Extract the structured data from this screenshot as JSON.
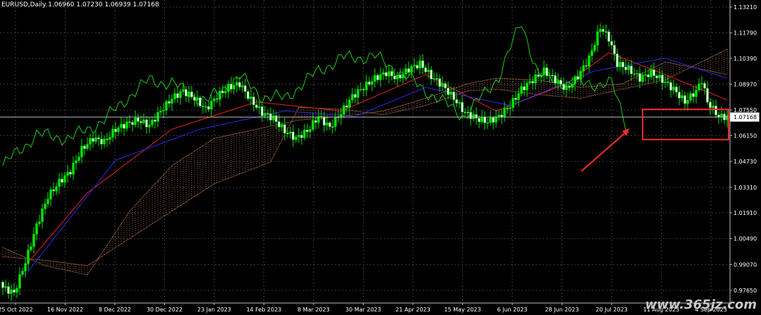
{
  "chart_data": {
    "type": "candlestick",
    "symbol_line": "EURUSD,Daily  1.06960 1.07230 1.06939 1.07168",
    "price_ticks": [
      "1.13210",
      "1.11790",
      "1.10390",
      "1.08970",
      "1.07550",
      "1.06150",
      "1.04730",
      "1.03310",
      "1.01910",
      "1.00490",
      "0.99070",
      "0.97650"
    ],
    "current_price": "1.07168",
    "x_ticks": [
      "25 Oct 2022",
      "16 Nov 2022",
      "8 Dec 2022",
      "30 Dec 2022",
      "23 Jan 2023",
      "14 Feb 2023",
      "8 Mar 2023",
      "30 Mar 2023",
      "21 Apr 2023",
      "15 May 2023",
      "6 Jun 2023",
      "28 Jun 2023",
      "20 Jul 2023",
      "11 Aug 2023",
      "4 Sep 2023"
    ],
    "grid": true,
    "close_keypoints": [
      [
        0,
        0.978
      ],
      [
        4,
        0.975
      ],
      [
        8,
        0.992
      ],
      [
        12,
        1.012
      ],
      [
        16,
        1.028
      ],
      [
        20,
        1.036
      ],
      [
        24,
        1.042
      ],
      [
        28,
        1.054
      ],
      [
        32,
        1.06
      ],
      [
        36,
        1.058
      ],
      [
        40,
        1.065
      ],
      [
        44,
        1.068
      ],
      [
        48,
        1.07
      ],
      [
        52,
        1.067
      ],
      [
        56,
        1.075
      ],
      [
        60,
        1.082
      ],
      [
        64,
        1.086
      ],
      [
        68,
        1.082
      ],
      [
        72,
        1.076
      ],
      [
        76,
        1.083
      ],
      [
        80,
        1.088
      ],
      [
        84,
        1.09
      ],
      [
        88,
        1.081
      ],
      [
        92,
        1.074
      ],
      [
        96,
        1.071
      ],
      [
        100,
        1.064
      ],
      [
        104,
        1.06
      ],
      [
        108,
        1.064
      ],
      [
        112,
        1.072
      ],
      [
        116,
        1.066
      ],
      [
        120,
        1.074
      ],
      [
        124,
        1.083
      ],
      [
        128,
        1.088
      ],
      [
        132,
        1.093
      ],
      [
        136,
        1.096
      ],
      [
        140,
        1.093
      ],
      [
        144,
        1.098
      ],
      [
        148,
        1.101
      ],
      [
        152,
        1.094
      ],
      [
        156,
        1.089
      ],
      [
        160,
        1.082
      ],
      [
        164,
        1.074
      ],
      [
        168,
        1.071
      ],
      [
        172,
        1.069
      ],
      [
        176,
        1.072
      ],
      [
        180,
        1.078
      ],
      [
        184,
        1.087
      ],
      [
        188,
        1.092
      ],
      [
        192,
        1.097
      ],
      [
        196,
        1.092
      ],
      [
        200,
        1.087
      ],
      [
        204,
        1.094
      ],
      [
        208,
        1.104
      ],
      [
        212,
        1.121
      ],
      [
        215,
        1.115
      ],
      [
        218,
        1.101
      ],
      [
        222,
        1.098
      ],
      [
        226,
        1.093
      ],
      [
        230,
        1.096
      ],
      [
        234,
        1.092
      ],
      [
        238,
        1.087
      ],
      [
        242,
        1.08
      ],
      [
        246,
        1.086
      ],
      [
        248,
        1.092
      ],
      [
        250,
        1.08
      ],
      [
        254,
        1.072
      ],
      [
        257,
        1.0717
      ]
    ],
    "lines": {
      "tenkan": {
        "color": "#e8231c",
        "keypoints": [
          [
            8,
            0.99
          ],
          [
            30,
            1.03
          ],
          [
            60,
            1.065
          ],
          [
            90,
            1.08
          ],
          [
            120,
            1.075
          ],
          [
            150,
            1.095
          ],
          [
            175,
            1.075
          ],
          [
            200,
            1.09
          ],
          [
            215,
            1.107
          ],
          [
            235,
            1.095
          ],
          [
            257,
            1.081
          ]
        ]
      },
      "kijun": {
        "color": "#2a2ae8",
        "keypoints": [
          [
            8,
            0.985
          ],
          [
            40,
            1.048
          ],
          [
            70,
            1.065
          ],
          [
            100,
            1.075
          ],
          [
            125,
            1.072
          ],
          [
            150,
            1.088
          ],
          [
            180,
            1.078
          ],
          [
            210,
            1.097
          ],
          [
            235,
            1.104
          ],
          [
            257,
            1.093
          ]
        ]
      },
      "chikou": {
        "color": "#1ec81e",
        "keypoints": [
          [
            0,
            1.045
          ],
          [
            12,
            1.062
          ],
          [
            24,
            1.06
          ],
          [
            36,
            1.07
          ],
          [
            44,
            1.082
          ],
          [
            52,
            1.092
          ],
          [
            60,
            1.09
          ],
          [
            72,
            1.08
          ],
          [
            84,
            1.094
          ],
          [
            92,
            1.083
          ],
          [
            100,
            1.082
          ],
          [
            112,
            1.097
          ],
          [
            120,
            1.104
          ],
          [
            132,
            1.105
          ],
          [
            144,
            1.093
          ],
          [
            152,
            1.084
          ],
          [
            164,
            1.072
          ],
          [
            176,
            1.094
          ],
          [
            184,
            1.124
          ],
          [
            190,
            1.095
          ],
          [
            200,
            1.09
          ],
          [
            210,
            1.09
          ],
          [
            216,
            1.09
          ],
          [
            222,
            1.064
          ]
        ]
      }
    },
    "cloud": {
      "span_a_keypoints": [
        [
          0,
          1.0
        ],
        [
          15,
          0.99
        ],
        [
          30,
          0.985
        ],
        [
          45,
          1.02
        ],
        [
          60,
          1.045
        ],
        [
          75,
          1.06
        ],
        [
          90,
          1.065
        ],
        [
          105,
          1.07
        ],
        [
          120,
          1.072
        ],
        [
          135,
          1.075
        ],
        [
          150,
          1.082
        ],
        [
          165,
          1.09
        ],
        [
          175,
          1.093
        ],
        [
          190,
          1.092
        ],
        [
          205,
          1.088
        ],
        [
          220,
          1.09
        ],
        [
          235,
          1.102
        ],
        [
          257,
          1.095
        ]
      ],
      "span_b_keypoints": [
        [
          0,
          0.995
        ],
        [
          15,
          0.993
        ],
        [
          30,
          0.99
        ],
        [
          45,
          1.005
        ],
        [
          60,
          1.02
        ],
        [
          75,
          1.035
        ],
        [
          95,
          1.047
        ],
        [
          105,
          1.077
        ],
        [
          120,
          1.076
        ],
        [
          135,
          1.073
        ],
        [
          150,
          1.078
        ],
        [
          165,
          1.086
        ],
        [
          175,
          1.087
        ],
        [
          190,
          1.084
        ],
        [
          205,
          1.082
        ],
        [
          220,
          1.087
        ],
        [
          235,
          1.092
        ],
        [
          257,
          1.109
        ]
      ],
      "color": "#c98150"
    },
    "colors": {
      "up": "#00e400",
      "down": "#ffffff",
      "grid": "#3a3a3a",
      "axis_text": "#ffffff",
      "annotation": "#ff2a2a"
    }
  },
  "watermark": "www.365jz.com"
}
